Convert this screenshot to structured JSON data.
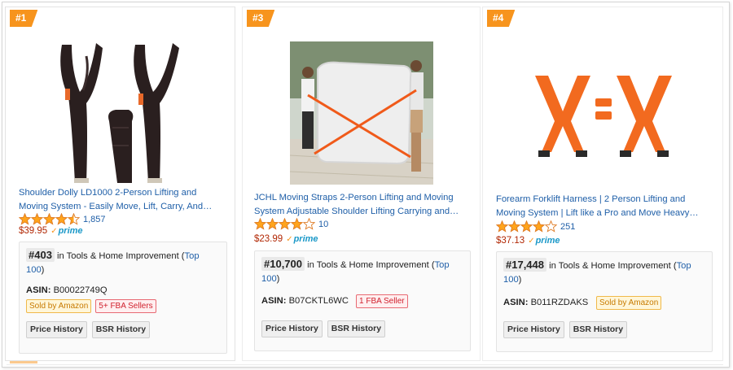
{
  "products": [
    {
      "rank_badge": "#1",
      "title_line1": "Shoulder Dolly LD1000 2-Person Lifting and",
      "title_line2": "Moving System - Easily Move, Lift, Carry, And…",
      "rating": 4.5,
      "review_count": "1,857",
      "price": "$39.95",
      "prime_label": "prime",
      "bsr_rank": "#403",
      "bsr_text": " in Tools & Home Improvement (",
      "bsr_link1": "Top",
      "bsr_link2": "100",
      "bsr_close": ")",
      "asin_label": "ASIN:",
      "asin_value": "B00022749Q",
      "tags": [
        "Sold by Amazon",
        "5+ FBA Sellers"
      ],
      "price_history_label": "Price History",
      "bsr_history_label": "BSR History",
      "image_icon": "black-shoulder-straps"
    },
    {
      "rank_badge": "#3",
      "title_line1": "JCHL Moving Straps 2-Person Lifting and Moving",
      "title_line2": "System Adjustable Shoulder Lifting Carrying and…",
      "rating": 4,
      "review_count": "10",
      "price": "$23.99",
      "prime_label": "prime",
      "bsr_rank": "#10,700",
      "bsr_text": " in Tools & Home Improvement (",
      "bsr_link1": "Top",
      "bsr_link2": "100",
      "bsr_close": ")",
      "asin_label": "ASIN:",
      "asin_value": "B07CKTL6WC",
      "tags": [
        "1 FBA Seller"
      ],
      "price_history_label": "Price History",
      "bsr_history_label": "BSR History",
      "image_icon": "two-men-carrying-mattress"
    },
    {
      "rank_badge": "#4",
      "title_line1": "Forearm Forklift Harness | 2 Person Lifting and",
      "title_line2": "Moving System | Lift like a Pro and Move Heavy…",
      "rating": 4,
      "review_count": "251",
      "price": "$37.13",
      "prime_label": "prime",
      "bsr_rank": "#17,448",
      "bsr_text": " in Tools & Home Improvement (",
      "bsr_link1": "Top",
      "bsr_link2": "100",
      "bsr_close": ")",
      "asin_label": "ASIN:",
      "asin_value": "B011RZDAKS",
      "tags": [
        "Sold by Amazon"
      ],
      "price_history_label": "Price History",
      "bsr_history_label": "BSR History",
      "image_icon": "orange-harness-straps"
    }
  ],
  "colors": {
    "badge": "#f7941d",
    "link": "#1f5fa8",
    "price": "#b12704",
    "star": "#ffa41c",
    "prime": "#1a98c8"
  }
}
